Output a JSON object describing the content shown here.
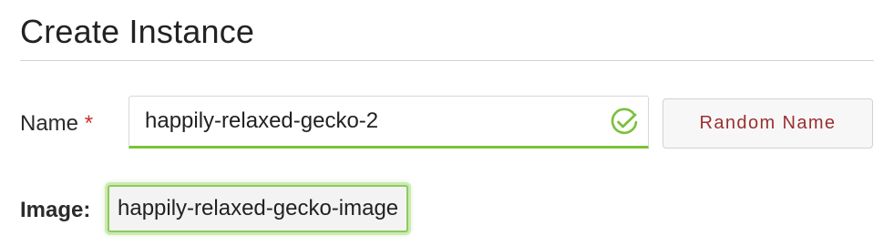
{
  "page": {
    "title": "Create Instance"
  },
  "form": {
    "name_label": "Name",
    "required_mark": "*",
    "name_value": "happily-relaxed-gecko-2",
    "name_status_icon": "check-circle-icon",
    "random_name_label": "Random Name",
    "image_label": "Image:",
    "image_value": "happily-relaxed-gecko-image"
  },
  "colors": {
    "accent_green": "#79c23a",
    "required_red": "#c9302c",
    "button_text": "#9a2f2f"
  }
}
